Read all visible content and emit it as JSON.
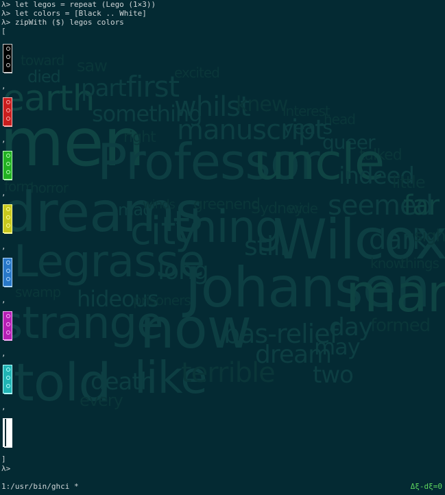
{
  "terminal": {
    "lines": [
      "λ> let legos = repeat (Lego (1×3))",
      "λ> let colors = [Black .. White]",
      "λ> zipWith ($) legos colors",
      "["
    ],
    "separator": ",",
    "close_bracket": "]",
    "prompt": "λ> "
  },
  "legos": [
    {
      "color": "Black",
      "hex": "#000000",
      "stud": "#d0d0d0"
    },
    {
      "color": "Red",
      "hex": "#c81e1e",
      "stud": "#ffb0b0"
    },
    {
      "color": "Green",
      "hex": "#22b022",
      "stud": "#b6ffb6"
    },
    {
      "color": "Yellow",
      "hex": "#c8c81e",
      "stud": "#ffff9a"
    },
    {
      "color": "Blue",
      "hex": "#2878c8",
      "stud": "#b0d8ff"
    },
    {
      "color": "Magenta",
      "hex": "#b420b4",
      "stud": "#ffb0ff"
    },
    {
      "color": "Cyan",
      "hex": "#20b4b4",
      "stud": "#b0ffff"
    },
    {
      "color": "White",
      "hex": "#ffffff",
      "stud": "#ffffff"
    }
  ],
  "statusbar": {
    "left": "1:/usr/bin/ghci *",
    "right": "Δξ-dξ=0",
    "right_color": "#5fd75f"
  },
  "wallpaper_words": [
    "toward",
    "saw",
    "died",
    "earth",
    "part",
    "first",
    "excited",
    "something",
    "whilst",
    "knew",
    "interest",
    "head",
    "men",
    "manuscript",
    "years",
    "right",
    "queer",
    "talked",
    "Professor",
    "uncle",
    "indeed",
    "little",
    "form",
    "horror",
    "dreams",
    "mad",
    "winds",
    "greenend",
    "Sydney",
    "wide",
    "seemed",
    "far",
    "city",
    "thing",
    "still",
    "Wilcox",
    "dark",
    "sight",
    "Legrasse",
    "long",
    "know",
    "things",
    "swamp",
    "hideous",
    "prisoners",
    "Johansen",
    "man",
    "strange",
    "now",
    "bas-relief",
    "day",
    "formed",
    "dream",
    "may",
    "told",
    "death",
    "like",
    "terrible",
    "two",
    "every"
  ]
}
